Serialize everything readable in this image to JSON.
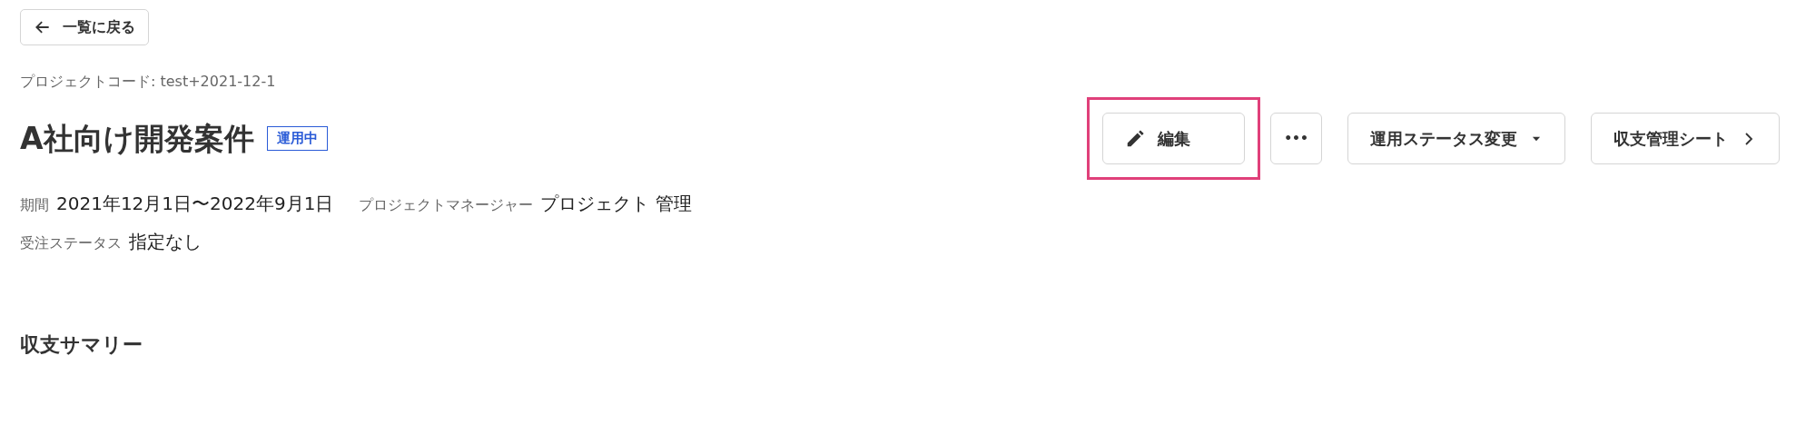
{
  "back_button": {
    "label": "一覧に戻る"
  },
  "project_code": "プロジェクトコード: test+2021-12-1",
  "title": "A社向け開発案件",
  "status_badge": "運用中",
  "actions": [
    {
      "kind": "edit",
      "label": "編集",
      "highlighted": true
    },
    {
      "kind": "more",
      "label": "•••",
      "highlighted": false
    },
    {
      "kind": "dropdown",
      "label": "運用ステータス変更",
      "highlighted": false
    },
    {
      "kind": "link",
      "label": "収支管理シート",
      "highlighted": false
    }
  ],
  "details": [
    [
      {
        "label": "期間",
        "value": "2021年12月1日〜2022年9月1日"
      },
      {
        "label": "プロジェクトマネージャー",
        "value": "プロジェクト 管理"
      }
    ],
    [
      {
        "label": "受注ステータス",
        "value": "指定なし"
      }
    ]
  ],
  "section_title": "収支サマリー"
}
